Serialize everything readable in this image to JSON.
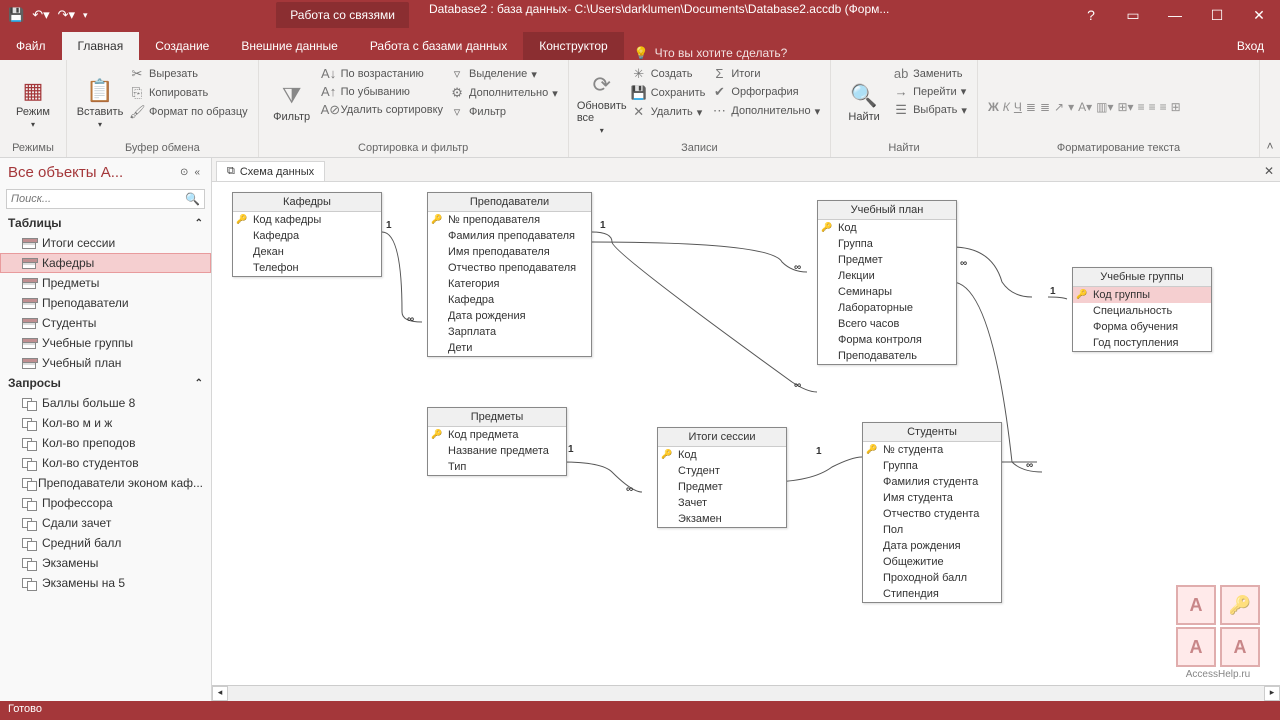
{
  "titlebar": {
    "tools_label": "Работа со связями",
    "filepath": "Database2 : база данных- C:\\Users\\darklumen\\Documents\\Database2.accdb (Форм...",
    "help": "?"
  },
  "tabs": {
    "file": "Файл",
    "home": "Главная",
    "create": "Создание",
    "external": "Внешние данные",
    "dbtools": "Работа с базами данных",
    "designer": "Конструктор",
    "tellme": "Что вы хотите сделать?",
    "login": "Вход"
  },
  "ribbon": {
    "mode": "Режим",
    "modes": "Режимы",
    "paste": "Вставить",
    "cut": "Вырезать",
    "copy": "Копировать",
    "formatpaint": "Формат по образцу",
    "clipboard": "Буфер обмена",
    "filter": "Фильтр",
    "sortasc": "По возрастанию",
    "sortdesc": "По убыванию",
    "clearsort": "Удалить сортировку",
    "selection": "Выделение",
    "advanced": "Дополнительно",
    "togglefilter": "Фильтр",
    "sortfilter": "Сортировка и фильтр",
    "refresh": "Обновить все",
    "new": "Создать",
    "save": "Сохранить",
    "delete": "Удалить",
    "totals": "Итоги",
    "spell": "Орфография",
    "more": "Дополнительно",
    "records": "Записи",
    "find": "Найти",
    "replace": "Заменить",
    "goto": "Перейти",
    "select": "Выбрать",
    "findgrp": "Найти",
    "formatting": "Форматирование текста"
  },
  "sidebar": {
    "title": "Все объекты A...",
    "search": "Поиск...",
    "tables_label": "Таблицы",
    "queries_label": "Запросы",
    "tables": [
      "Итоги сессии",
      "Кафедры",
      "Предметы",
      "Преподаватели",
      "Студенты",
      "Учебные группы",
      "Учебный план"
    ],
    "queries": [
      "Баллы больше 8",
      "Кол-во м и ж",
      "Кол-во преподов",
      "Кол-во студентов",
      "Преподаватели эконом каф...",
      "Профессора",
      "Сдали зачет",
      "Средний балл",
      "Экзамены",
      "Экзамены на 5"
    ]
  },
  "doctab": "Схема данных",
  "diagram": {
    "kaf": {
      "title": "Кафедры",
      "fields": [
        "Код кафедры",
        "Кафедра",
        "Декан",
        "Телефон"
      ],
      "keys": [
        0
      ]
    },
    "prep": {
      "title": "Преподаватели",
      "fields": [
        "№ преподавателя",
        "Фамилия преподавателя",
        "Имя преподавателя",
        "Отчество преподавателя",
        "Категория",
        "Кафедра",
        "Дата рождения",
        "Зарплата",
        "Дети"
      ],
      "keys": [
        0
      ]
    },
    "pred": {
      "title": "Предметы",
      "fields": [
        "Код предмета",
        "Название предмета",
        "Тип"
      ],
      "keys": [
        0
      ]
    },
    "itog": {
      "title": "Итоги сессии",
      "fields": [
        "Код",
        "Студент",
        "Предмет",
        "Зачет",
        "Экзамен"
      ],
      "keys": [
        0
      ]
    },
    "plan": {
      "title": "Учебный план",
      "fields": [
        "Код",
        "Группа",
        "Предмет",
        "Лекции",
        "Семинары",
        "Лабораторные",
        "Всего часов",
        "Форма контроля",
        "Преподаватель"
      ],
      "keys": [
        0
      ]
    },
    "stud": {
      "title": "Студенты",
      "fields": [
        "№ студента",
        "Группа",
        "Фамилия студента",
        "Имя студента",
        "Отчество студента",
        "Пол",
        "Дата рождения",
        "Общежитие",
        "Проходной балл",
        "Стипендия"
      ],
      "keys": [
        0
      ]
    },
    "grup": {
      "title": "Учебные группы",
      "fields": [
        "Код группы",
        "Специальность",
        "Форма обучения",
        "Год поступления"
      ],
      "keys": [
        0
      ]
    }
  },
  "rel_labels": {
    "one": "1",
    "many": "∞"
  },
  "status": "Готово",
  "watermark": "AccessHelp.ru"
}
